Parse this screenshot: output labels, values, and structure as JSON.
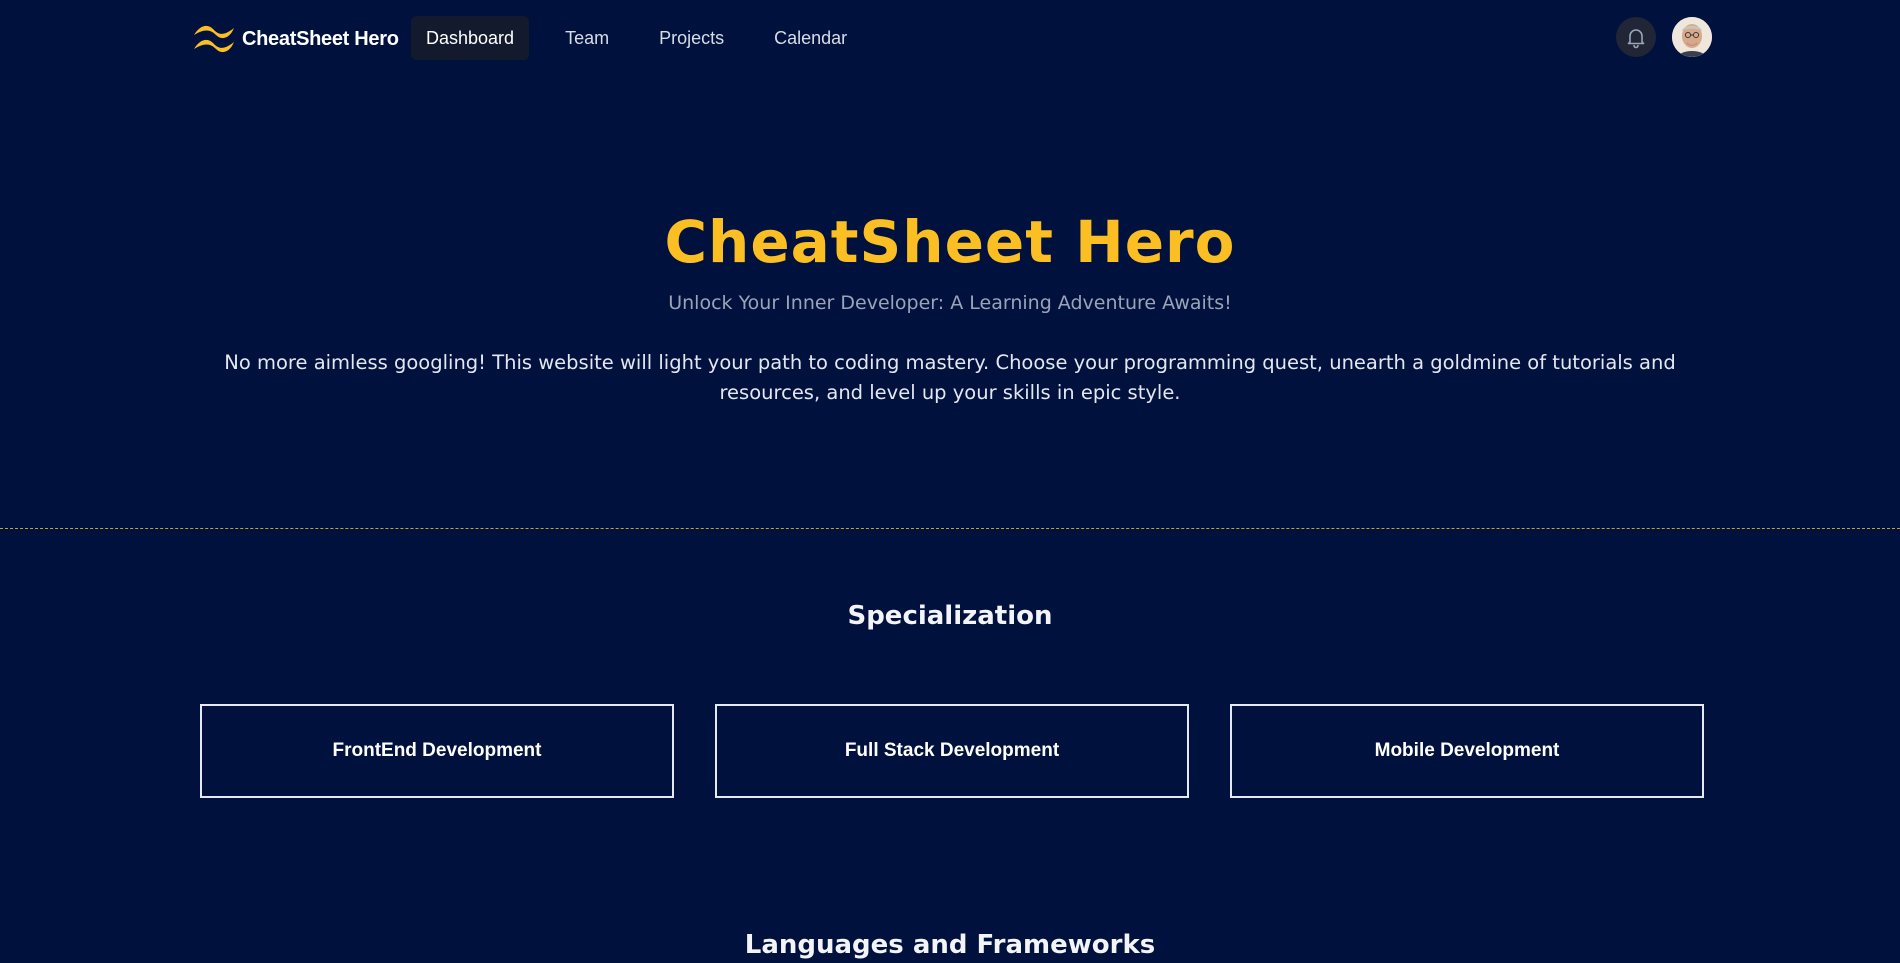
{
  "brand": {
    "name": "CheatSheet Hero",
    "logo_icon": "tailwind-wave-icon",
    "accent_color": "#fbbf24"
  },
  "nav": {
    "links": [
      {
        "label": "Dashboard",
        "active": true
      },
      {
        "label": "Team",
        "active": false
      },
      {
        "label": "Projects",
        "active": false
      },
      {
        "label": "Calendar",
        "active": false
      }
    ],
    "notification_icon": "bell-icon",
    "avatar_icon": "user-avatar"
  },
  "hero": {
    "title": "CheatSheet Hero",
    "subtitle": "Unlock Your Inner Developer: A Learning Adventure Awaits!",
    "description": "No more aimless googling! This website will light your path to coding mastery. Choose your programming quest, unearth a goldmine of tutorials and resources, and level up your skills in epic style."
  },
  "specialization": {
    "title": "Specialization",
    "cards": [
      {
        "label": "FrontEnd Development"
      },
      {
        "label": "Full Stack Development"
      },
      {
        "label": "Mobile Development"
      }
    ]
  },
  "languages": {
    "title": "Languages and Frameworks"
  },
  "colors": {
    "background": "#00113d",
    "title": "#fbbf24",
    "divider": "#c9a227"
  }
}
